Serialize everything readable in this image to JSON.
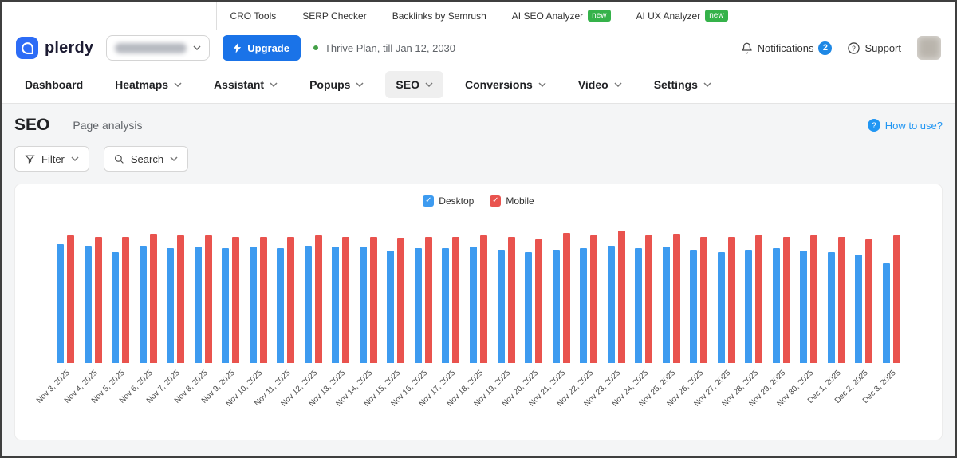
{
  "topbar": {
    "tabs": [
      {
        "label": "CRO Tools",
        "badge": "",
        "active": true
      },
      {
        "label": "SERP Checker",
        "badge": "",
        "active": false
      },
      {
        "label": "Backlinks by Semrush",
        "badge": "",
        "active": false
      },
      {
        "label": "AI SEO Analyzer",
        "badge": "new",
        "active": false
      },
      {
        "label": "AI UX Analyzer",
        "badge": "new",
        "active": false
      }
    ]
  },
  "header": {
    "brand": "plerdy",
    "upgrade_label": "Upgrade",
    "plan_text": "Thrive Plan, till Jan 12, 2030",
    "notifications_label": "Notifications",
    "notifications_count": "2",
    "support_label": "Support"
  },
  "nav": {
    "items": [
      {
        "label": "Dashboard"
      },
      {
        "label": "Heatmaps"
      },
      {
        "label": "Assistant"
      },
      {
        "label": "Popups"
      },
      {
        "label": "SEO"
      },
      {
        "label": "Conversions"
      },
      {
        "label": "Video"
      },
      {
        "label": "Settings"
      }
    ]
  },
  "page": {
    "title": "SEO",
    "subtitle": "Page analysis",
    "help_label": "How to use?"
  },
  "toolbar": {
    "filter_label": "Filter",
    "search_label": "Search"
  },
  "colors": {
    "accent_blue": "#1a73e8",
    "badge_green": "#35b24a",
    "desktop_bar": "#3d9bf0",
    "mobile_bar": "#e9534e"
  },
  "chart_data": {
    "type": "bar",
    "title": "",
    "xlabel": "",
    "ylabel": "",
    "grid": false,
    "legend_position": "top",
    "ylim": [
      0,
      110
    ],
    "categories": [
      "Nov 3, 2025",
      "Nov 4, 2025",
      "Nov 5, 2025",
      "Nov 6, 2025",
      "Nov 7, 2025",
      "Nov 8, 2025",
      "Nov 9, 2025",
      "Nov 10, 2025",
      "Nov 11, 2025",
      "Nov 12, 2025",
      "Nov 13, 2025",
      "Nov 14, 2025",
      "Nov 15, 2025",
      "Nov 16, 2025",
      "Nov 17, 2025",
      "Nov 18, 2025",
      "Nov 19, 2025",
      "Nov 20, 2025",
      "Nov 21, 2025",
      "Nov 22, 2025",
      "Nov 23, 2025",
      "Nov 24, 2025",
      "Nov 25, 2025",
      "Nov 26, 2025",
      "Nov 27, 2025",
      "Nov 28, 2025",
      "Nov 29, 2025",
      "Nov 30, 2025",
      "Dec 1, 2025",
      "Dec 2, 2025",
      "Dec 3, 2025"
    ],
    "series": [
      {
        "name": "Desktop",
        "color": "#3d9bf0",
        "values": [
          93,
          92,
          87,
          92,
          90,
          91,
          90,
          91,
          90,
          92,
          91,
          91,
          88,
          90,
          90,
          91,
          89,
          87,
          89,
          90,
          92,
          90,
          91,
          89,
          87,
          89,
          90,
          88,
          87,
          85,
          78
        ]
      },
      {
        "name": "Mobile",
        "color": "#e9534e",
        "values": [
          100,
          99,
          99,
          101,
          100,
          100,
          99,
          99,
          99,
          100,
          99,
          99,
          98,
          99,
          99,
          100,
          99,
          97,
          102,
          100,
          104,
          100,
          101,
          99,
          99,
          100,
          99,
          100,
          99,
          97,
          100
        ]
      }
    ]
  }
}
